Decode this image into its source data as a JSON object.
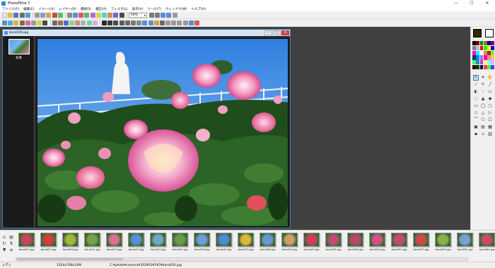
{
  "app": {
    "title": "PhotoFiltre 7"
  },
  "window_controls": {
    "minimize": "—",
    "maximize": "☐",
    "close": "✕"
  },
  "menu": [
    "ファイル(F)",
    "編集(E)",
    "イメージ(I)",
    "レイヤー(R)",
    "選択(S)",
    "補正(A)",
    "フィルタ(L)",
    "表示(V)",
    "ツール(T)",
    "ウィンドウ(W)",
    "ヘルプ(H)"
  ],
  "toolbar": {
    "zoom": "50%"
  },
  "document": {
    "title": "bara030.jpg",
    "layer_label": "背景"
  },
  "thumbnails": [
    {
      "label": "bara001.jpg",
      "color": "#c8445a"
    },
    {
      "label": "bara007.jpg",
      "color": "#d63b3b"
    },
    {
      "label": "bara008.jpg",
      "color": "#a9b23a"
    },
    {
      "label": "bara011.jpg",
      "color": "#7aa04a"
    },
    {
      "label": "bara013.jpg",
      "color": "#df6e93"
    },
    {
      "label": "bara022.jpg",
      "color": "#5a8ed6"
    },
    {
      "label": "bara024.jpg",
      "color": "#6fa8c6"
    },
    {
      "label": "bara025.jpg",
      "color": "#6c9a4a"
    },
    {
      "label": "bara028.jpg",
      "color": "#6f9bd8"
    },
    {
      "label": "bara030.jpg",
      "color": "#4f86d6"
    },
    {
      "label": "bara033.jpg",
      "color": "#e0b53a"
    },
    {
      "label": "bara038.jpg",
      "color": "#6a96d6"
    },
    {
      "label": "bara039.jpg",
      "color": "#d49a6a"
    },
    {
      "label": "bara043.jpg",
      "color": "#d33b5a"
    },
    {
      "label": "bara045.jpg",
      "color": "#c14a7a"
    },
    {
      "label": "bara046.jpg",
      "color": "#b84868"
    },
    {
      "label": "bara049.jpg",
      "color": "#d4508a"
    },
    {
      "label": "bara051.jpg",
      "color": "#c8457a"
    },
    {
      "label": "bara057.jpg",
      "color": "#d1474f"
    },
    {
      "label": "bara059.jpg",
      "color": "#8bb04a"
    },
    {
      "label": "bara061.jpg",
      "color": "#7aa0d6"
    },
    {
      "label": "bara064.jpg",
      "color": "#c84a6a"
    }
  ],
  "status": {
    "mode": "レディ",
    "size": "1024x768x16M",
    "path": "C:¥photo¥camera¥201903¥1¥5¥bara030.jpg"
  },
  "colors": {
    "workspace": "#404040",
    "fg": "#2e2a00",
    "bg": "#ffffff",
    "accent": "#3c7fb1"
  }
}
